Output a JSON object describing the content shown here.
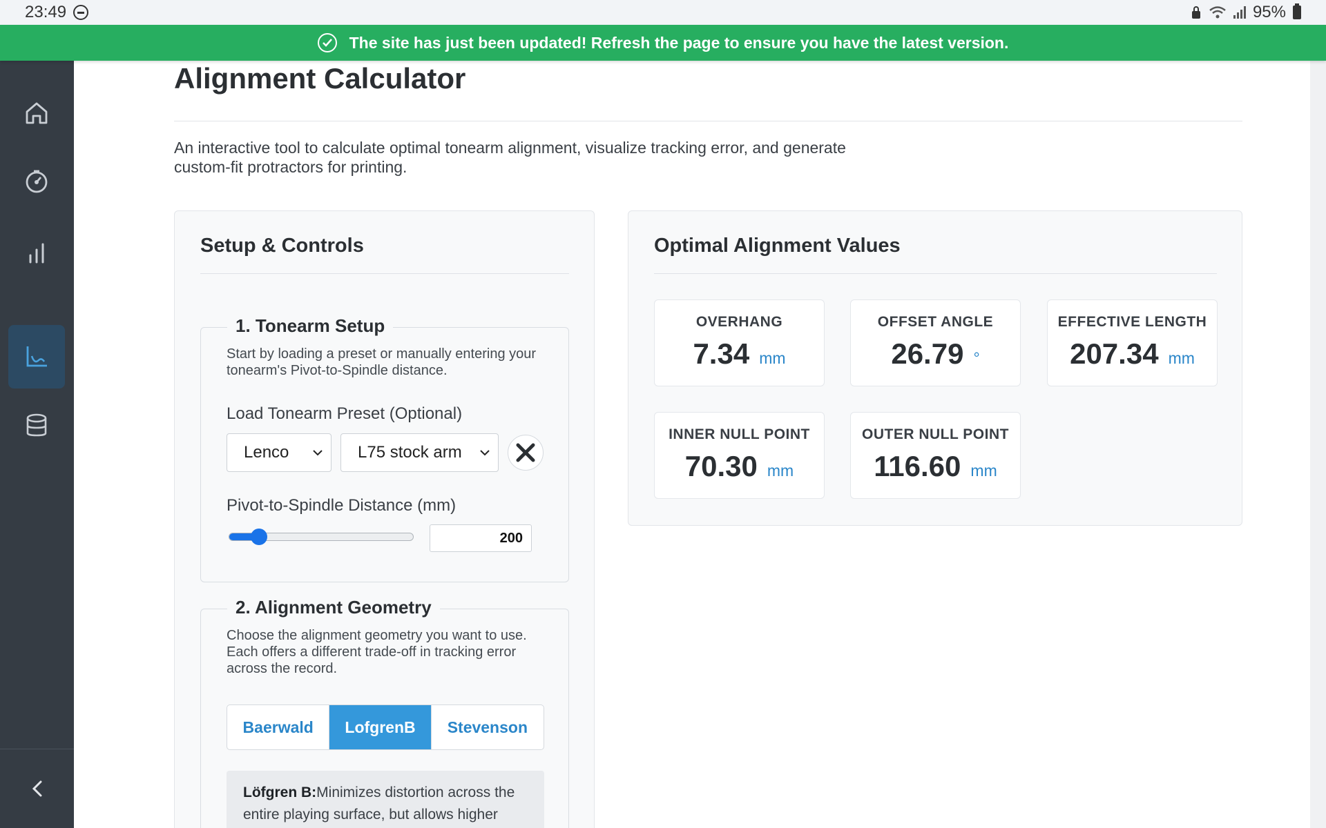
{
  "status_bar": {
    "time": "23:49",
    "battery": "95%"
  },
  "banner": {
    "message": "The site has just been updated! Refresh the page to ensure you have the latest version."
  },
  "sidebar": {
    "items": [
      {
        "icon": "home-icon"
      },
      {
        "icon": "gauge-icon"
      },
      {
        "icon": "bar-chart-icon"
      },
      {
        "icon": "plot-icon",
        "active": true
      },
      {
        "icon": "database-icon"
      }
    ],
    "collapse_icon": "chevron-left-icon"
  },
  "page": {
    "title": "Alignment Calculator",
    "intro": "An interactive tool to calculate optimal tonearm alignment, visualize tracking error, and generate custom-fit protractors for printing."
  },
  "setup": {
    "title": "Setup & Controls",
    "tonearm": {
      "legend": "1. Tonearm Setup",
      "help": "Start by loading a preset or manually entering your tonearm's Pivot-to-Spindle distance.",
      "preset_label": "Load Tonearm Preset (Optional)",
      "manufacturer": "Lenco",
      "model": "L75 stock arm",
      "distance_label": "Pivot-to-Spindle Distance (mm)",
      "distance_value": "200",
      "slider_fraction": 0.16
    },
    "geometry": {
      "legend": "2. Alignment Geometry",
      "help": "Choose the alignment geometry you want to use. Each offers a different trade-off in tracking error across the record.",
      "options": [
        "Baerwald",
        "LofgrenB",
        "Stevenson"
      ],
      "selected": "LofgrenB",
      "description_title": "Löfgren B:",
      "description_text": "Minimizes distortion across the entire playing surface, but allows higher"
    }
  },
  "results": {
    "title": "Optimal Alignment Values",
    "cards": [
      {
        "label": "OVERHANG",
        "value": "7.34",
        "unit": "mm"
      },
      {
        "label": "OFFSET ANGLE",
        "value": "26.79",
        "unit": "°"
      },
      {
        "label": "EFFECTIVE LENGTH",
        "value": "207.34",
        "unit": "mm"
      },
      {
        "label": "INNER NULL POINT",
        "value": "70.30",
        "unit": "mm"
      },
      {
        "label": "OUTER NULL POINT",
        "value": "116.60",
        "unit": "mm"
      }
    ]
  },
  "colors": {
    "banner": "#27ae60",
    "sidebar": "#353c44",
    "accent": "#3498db",
    "slider": "#1a73e8"
  }
}
